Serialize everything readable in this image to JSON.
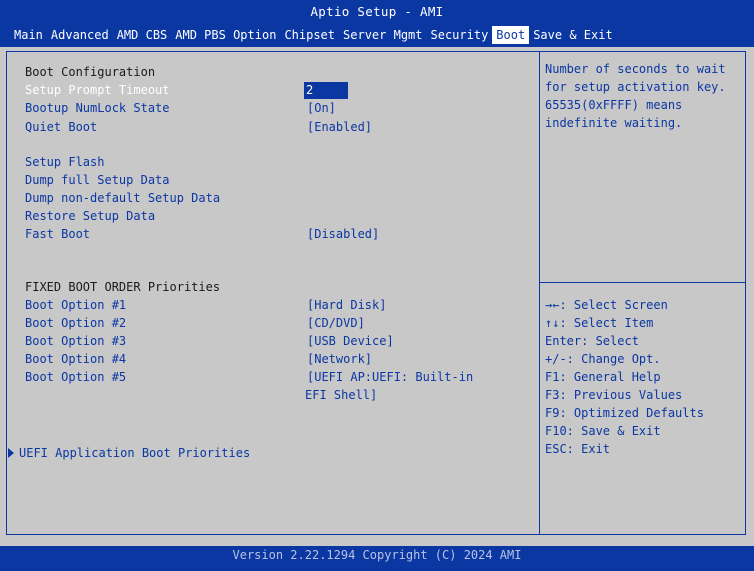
{
  "header": {
    "title": "Aptio Setup - AMI",
    "menu": [
      "Main",
      "Advanced",
      "AMD CBS",
      "AMD PBS Option",
      "Chipset",
      "Server Mgmt",
      "Security",
      "Boot",
      "Save & Exit"
    ],
    "active_menu": "Boot"
  },
  "boot": {
    "section_title": "Boot Configuration",
    "setup_prompt_timeout": {
      "label": "Setup Prompt Timeout",
      "value": "2"
    },
    "bootup_numlock": {
      "label": "Bootup NumLock State",
      "value": "[On]"
    },
    "quiet_boot": {
      "label": "Quiet Boot",
      "value": "[Enabled]"
    },
    "setup_flash": "Setup Flash",
    "dump_full": "Dump full Setup Data",
    "dump_non_default": "Dump non-default Setup Data",
    "restore_setup": "Restore Setup Data",
    "fast_boot": {
      "label": "Fast Boot",
      "value": "[Disabled]"
    },
    "fixed_order_title": "FIXED BOOT ORDER Priorities",
    "options": [
      {
        "label": "Boot Option #1",
        "value": "[Hard Disk]"
      },
      {
        "label": "Boot Option #2",
        "value": "[CD/DVD]"
      },
      {
        "label": "Boot Option #3",
        "value": "[USB Device]"
      },
      {
        "label": "Boot Option #4",
        "value": "[Network]"
      },
      {
        "label": "Boot Option #5",
        "value": "[UEFI AP:UEFI: Built-in",
        "value_line2": "EFI Shell]"
      }
    ],
    "uefi_app_priorities": "UEFI Application Boot Priorities"
  },
  "help": {
    "description": "Number of seconds to wait for setup activation key. 65535(0xFFFF) means indefinite waiting.",
    "keys": [
      "→←: Select Screen",
      "↑↓: Select Item",
      "Enter: Select",
      "+/-: Change Opt.",
      "F1: General Help",
      "F3: Previous Values",
      "F9: Optimized Defaults",
      "F10: Save & Exit",
      "ESC: Exit"
    ]
  },
  "footer": {
    "text": "Version 2.22.1294 Copyright (C) 2024 AMI"
  },
  "colors": {
    "bios_blue": "#0b37a3",
    "background": "#c8c8c8",
    "text_white": "#ffffff"
  }
}
